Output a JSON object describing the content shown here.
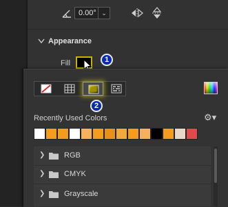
{
  "transform": {
    "rotation_value": "0.00°"
  },
  "appearance": {
    "title": "Appearance",
    "fill_label": "Fill",
    "fill_color": "#000000",
    "fill_highlight": "#c7b300"
  },
  "steps": {
    "badge1": "1",
    "badge2": "2"
  },
  "color_picker": {
    "recent_title": "Recently Used Colors",
    "recent_colors": [
      "#ffffff",
      "#f39c1e",
      "#f39c1e",
      "#ffffff",
      "#f6b25a",
      "#f39c1e",
      "#e8901a",
      "#f2a83a",
      "#f39c1e",
      "#f6b25a",
      "#000000",
      "#f39c1e",
      "#e8d8c8",
      "#e04a4a"
    ],
    "folders": [
      {
        "label": "RGB"
      },
      {
        "label": "CMYK"
      },
      {
        "label": "Grayscale"
      }
    ]
  },
  "icons": {
    "rotate": "angle-icon",
    "flip_h": "flip-horizontal-icon",
    "flip_v": "flip-vertical-icon",
    "gear": "gear-icon",
    "folder": "folder-icon"
  }
}
